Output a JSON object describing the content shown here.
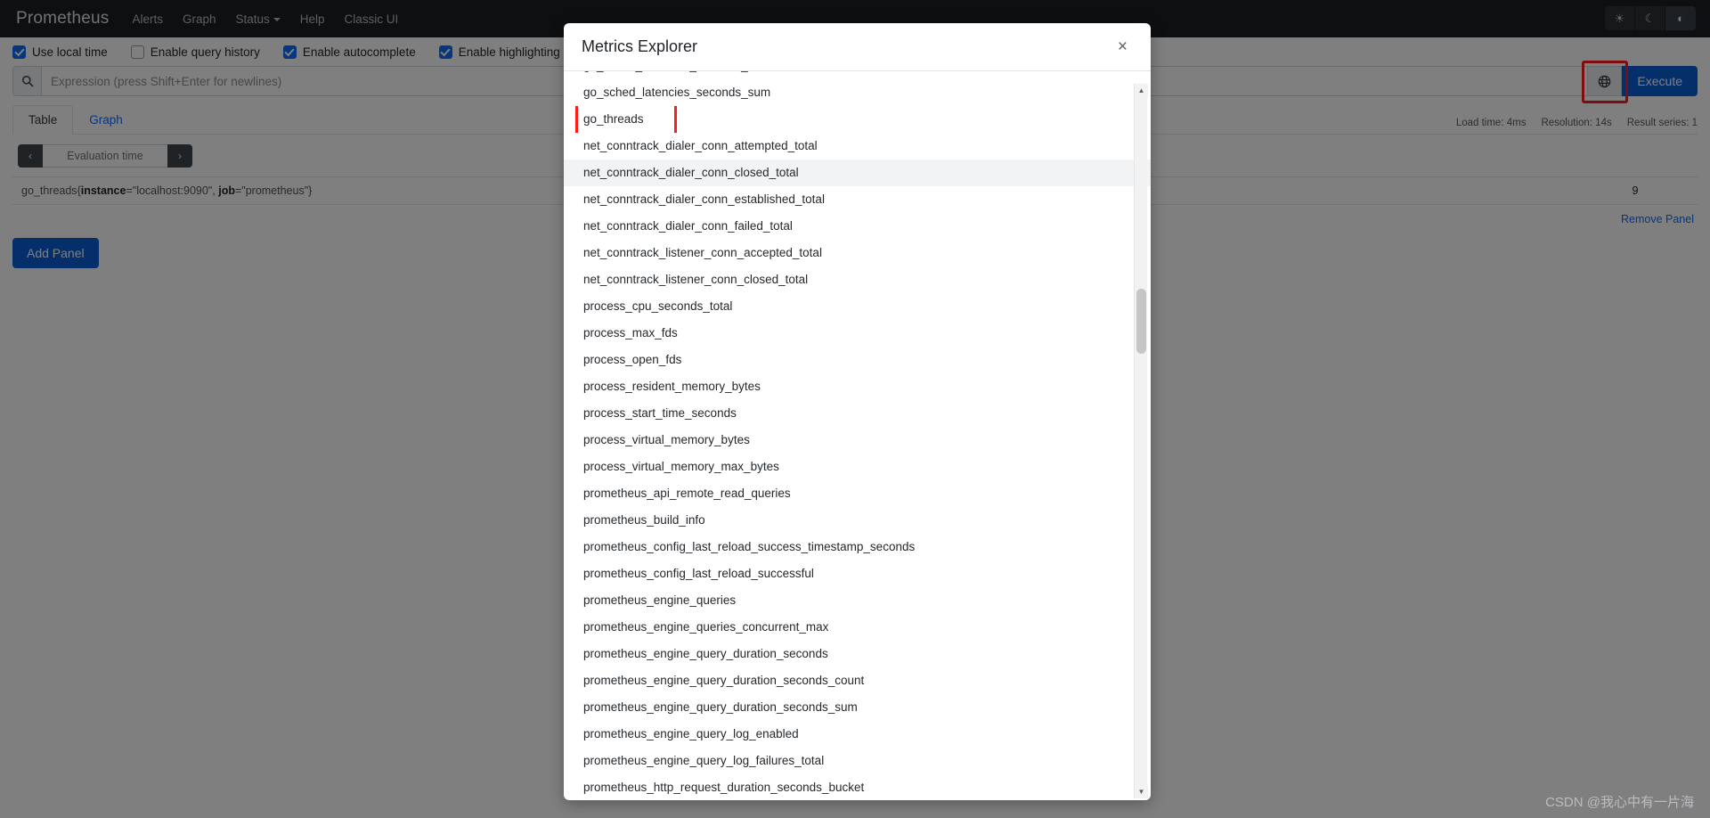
{
  "navbar": {
    "brand": "Prometheus",
    "links": [
      {
        "label": "Alerts",
        "has_caret": false
      },
      {
        "label": "Graph",
        "has_caret": false
      },
      {
        "label": "Status",
        "has_caret": true
      },
      {
        "label": "Help",
        "has_caret": false
      },
      {
        "label": "Classic UI",
        "has_caret": false
      }
    ],
    "theme_buttons": [
      {
        "icon": "sun-icon",
        "glyph": "☀"
      },
      {
        "icon": "moon-icon",
        "glyph": "☾"
      },
      {
        "icon": "half-circle-auto-icon",
        "glyph": "◐"
      }
    ]
  },
  "options": [
    {
      "label": "Use local time",
      "checked": true
    },
    {
      "label": "Enable query history",
      "checked": false
    },
    {
      "label": "Enable autocomplete",
      "checked": true
    },
    {
      "label": "Enable highlighting",
      "checked": true
    }
  ],
  "query_bar": {
    "search_icon": "search-icon",
    "expression_value": "",
    "expression_placeholder": "Expression (press Shift+Enter for newlines)",
    "metrics_explorer_icon": "globe-icon",
    "metrics_explorer_glyph": "ἱ0",
    "execute_label": "Execute",
    "highlight_color": "#ff1b1b"
  },
  "panel": {
    "tabs": [
      {
        "label": "Table",
        "active": true
      },
      {
        "label": "Graph",
        "active": false
      }
    ],
    "stats": [
      {
        "label": "Load time: 4ms"
      },
      {
        "label": "Resolution: 14s"
      },
      {
        "label": "Result series: 1"
      }
    ],
    "evaluation_time": {
      "prev_glyph": "‹",
      "label": "Evaluation time",
      "next_glyph": "›"
    },
    "result": {
      "metric_name": "go_threads",
      "label_instance_key": "instance",
      "label_instance_val": "=\"localhost:9090\", ",
      "label_job_key": "job",
      "label_job_val": "=\"prometheus\"}",
      "open_brace": "{",
      "value": "9"
    },
    "remove_panel_label": "Remove Panel",
    "add_panel_label": "Add Panel"
  },
  "modal": {
    "title": "Metrics Explorer",
    "close_glyph": "×",
    "scroll_up_glyph": "▲",
    "scroll_down_glyph": "▼",
    "selected_metric": "go_threads",
    "hovered_metric": "net_conntrack_dialer_conn_closed_total",
    "metrics": [
      "go_sched_latencies_seconds_count",
      "go_sched_latencies_seconds_sum",
      "go_threads",
      "net_conntrack_dialer_conn_attempted_total",
      "net_conntrack_dialer_conn_closed_total",
      "net_conntrack_dialer_conn_established_total",
      "net_conntrack_dialer_conn_failed_total",
      "net_conntrack_listener_conn_accepted_total",
      "net_conntrack_listener_conn_closed_total",
      "process_cpu_seconds_total",
      "process_max_fds",
      "process_open_fds",
      "process_resident_memory_bytes",
      "process_start_time_seconds",
      "process_virtual_memory_bytes",
      "process_virtual_memory_max_bytes",
      "prometheus_api_remote_read_queries",
      "prometheus_build_info",
      "prometheus_config_last_reload_success_timestamp_seconds",
      "prometheus_config_last_reload_successful",
      "prometheus_engine_queries",
      "prometheus_engine_queries_concurrent_max",
      "prometheus_engine_query_duration_seconds",
      "prometheus_engine_query_duration_seconds_count",
      "prometheus_engine_query_duration_seconds_sum",
      "prometheus_engine_query_log_enabled",
      "prometheus_engine_query_log_failures_total",
      "prometheus_http_request_duration_seconds_bucket"
    ]
  },
  "watermark": "CSDN @我心中有一片海"
}
